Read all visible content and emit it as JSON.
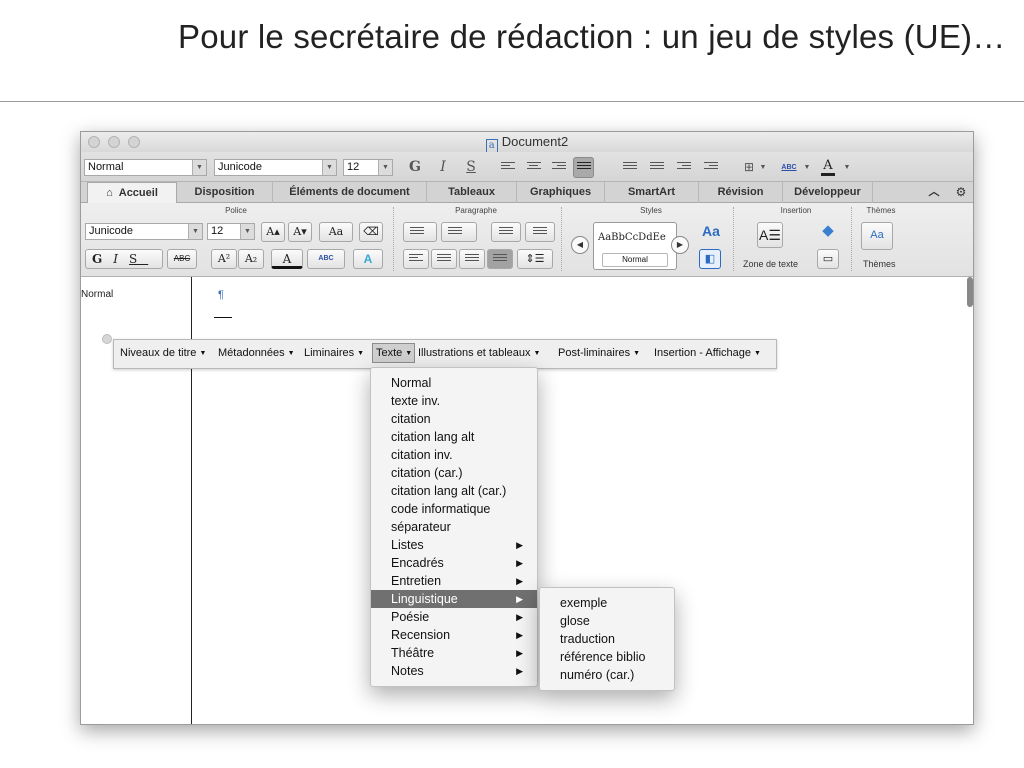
{
  "slide": {
    "title": "Pour le secrétaire de rédaction : un jeu de styles (UE)…"
  },
  "window": {
    "title": "Document2",
    "doc_icon": "a",
    "toolbar": {
      "style_name": "Normal",
      "font_name": "Junicode",
      "font_size": "12",
      "bold": "G",
      "italic": "I",
      "underline": "S",
      "char_style_label": "ABC",
      "font_color_label": "A"
    },
    "tabs": [
      "Accueil",
      "Disposition",
      "Éléments de document",
      "Tableaux",
      "Graphiques",
      "SmartArt",
      "Révision",
      "Développeur"
    ],
    "ribbon": {
      "groups": {
        "police": "Police",
        "paragraphe": "Paragraphe",
        "styles": "Styles",
        "insertion": "Insertion",
        "themes": "Thèmes"
      },
      "font_name": "Junicode",
      "font_size": "12",
      "bold": "G",
      "italic": "I",
      "underline": "S",
      "strike": "ABC",
      "superscript": "A²",
      "subscript": "A₂",
      "grow": "A▴",
      "shrink": "A▾",
      "change_case": "Aa",
      "highlight": "ABC",
      "text_effects": "A",
      "styles_sample": "AaBbCcDdEe",
      "styles_current": "Normal",
      "text_box_label": "Zone de texte",
      "themes_label": "Thèmes",
      "themes_icon_text": "Aa"
    },
    "document": {
      "style_pane_label": "Normal",
      "pilcrow": "¶"
    },
    "floating_toolbar": {
      "items": [
        "Niveaux de titre",
        "Métadonnées",
        "Liminaires",
        "Texte",
        "Illustrations et tableaux",
        "Post-liminaires",
        "Insertion - Affichage"
      ],
      "active": "Texte"
    },
    "texte_menu": {
      "items": [
        {
          "label": "Normal",
          "submenu": false
        },
        {
          "label": "texte inv.",
          "submenu": false
        },
        {
          "label": "citation",
          "submenu": false
        },
        {
          "label": "citation lang alt",
          "submenu": false
        },
        {
          "label": "citation inv.",
          "submenu": false
        },
        {
          "label": "citation (car.)",
          "submenu": false
        },
        {
          "label": "citation lang alt (car.)",
          "submenu": false
        },
        {
          "label": "code informatique",
          "submenu": false
        },
        {
          "label": "séparateur",
          "submenu": false
        },
        {
          "label": "Listes",
          "submenu": true
        },
        {
          "label": "Encadrés",
          "submenu": true
        },
        {
          "label": "Entretien",
          "submenu": true
        },
        {
          "label": "Linguistique",
          "submenu": true,
          "highlighted": true
        },
        {
          "label": "Poésie",
          "submenu": true
        },
        {
          "label": "Recension",
          "submenu": true
        },
        {
          "label": "Théâtre",
          "submenu": true
        },
        {
          "label": "Notes",
          "submenu": true
        }
      ]
    },
    "linguistique_submenu": {
      "items": [
        "exemple",
        "glose",
        "traduction",
        "référence biblio",
        "numéro (car.)"
      ]
    }
  }
}
